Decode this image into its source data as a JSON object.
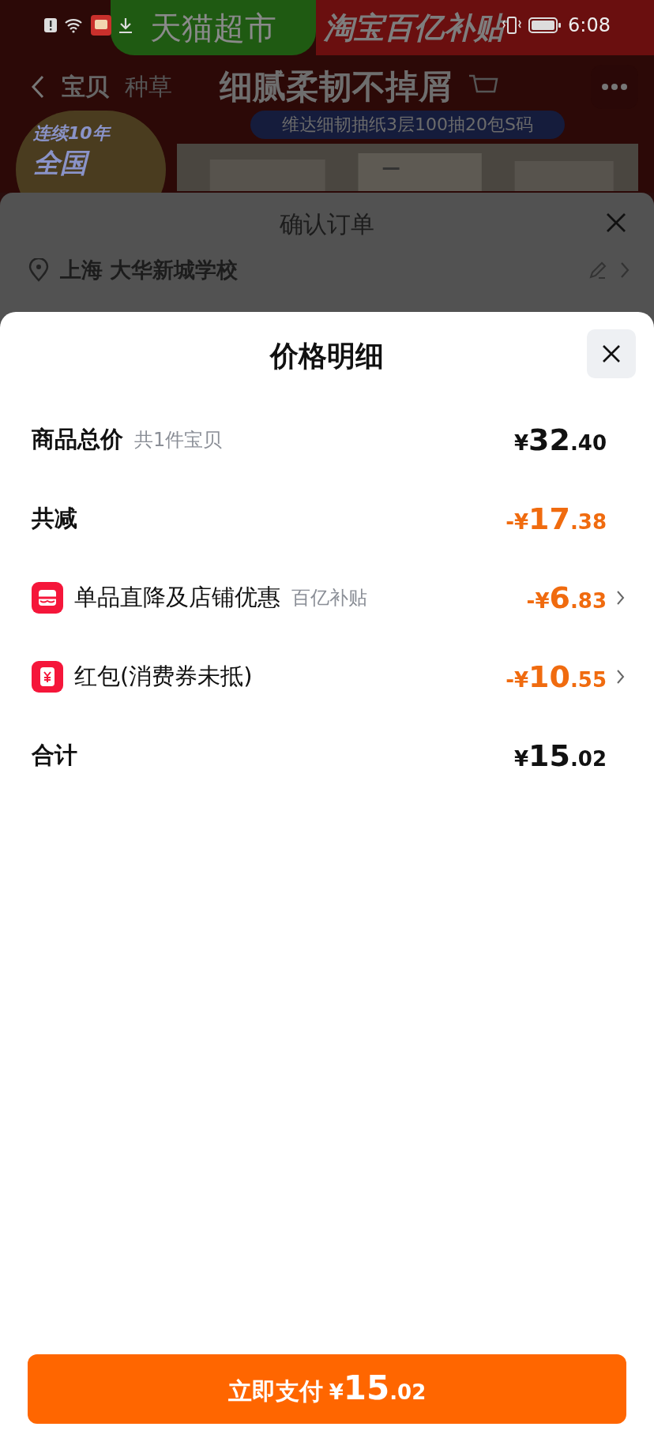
{
  "status_bar": {
    "time": "6:08"
  },
  "background_page": {
    "banners": [
      {
        "label": "天猫超市",
        "color": "#1f5a12"
      },
      {
        "label": "淘宝百亿补贴",
        "color": "#6a0f0f"
      }
    ],
    "tabs": [
      {
        "label": "宝贝",
        "selected": true
      },
      {
        "label": "种草",
        "selected": false
      }
    ],
    "headline": "细腻柔韧不掉屑",
    "product_tag": "维达细韧抽纸3层100抽20包S码",
    "badge_lines": [
      "连续10年",
      "全国"
    ]
  },
  "order_sheet": {
    "title": "确认订单",
    "address": "上海 大华新城学校"
  },
  "price_sheet": {
    "title": "价格明细",
    "rows": [
      {
        "kind": "heading",
        "label": "商品总价",
        "note": "共1件宝贝",
        "prefix": "¥",
        "main": "32",
        "fraction": ".40",
        "discount": false,
        "has_detail": false
      },
      {
        "kind": "heading",
        "label": "共减",
        "prefix": "-¥",
        "main": "17",
        "fraction": ".38",
        "discount": true,
        "has_detail": false
      },
      {
        "kind": "store",
        "label": "单品直降及店铺优惠",
        "note": "百亿补贴",
        "prefix": "-¥",
        "main": "6",
        "fraction": ".83",
        "discount": true,
        "has_detail": true
      },
      {
        "kind": "coupon",
        "label": "红包(消费券未抵)",
        "prefix": "-¥",
        "main": "10",
        "fraction": ".55",
        "discount": true,
        "has_detail": true
      },
      {
        "kind": "heading",
        "label": "合计",
        "prefix": "¥",
        "main": "15",
        "fraction": ".02",
        "discount": false,
        "has_detail": false
      }
    ]
  },
  "pay_button": {
    "label": "立即支付",
    "prefix": "¥",
    "main": "15",
    "fraction": ".02"
  }
}
